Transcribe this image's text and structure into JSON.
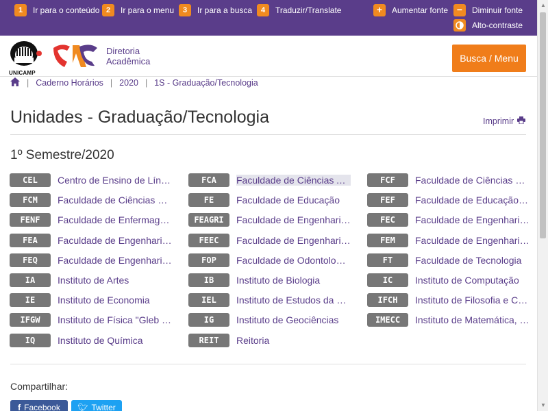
{
  "a11y": {
    "skip_content": {
      "num": "1",
      "label": "Ir para o conteúdo"
    },
    "skip_menu": {
      "num": "2",
      "label": "Ir para o menu"
    },
    "skip_search": {
      "num": "3",
      "label": "Ir para a busca"
    },
    "translate": {
      "num": "4",
      "label": "Traduzir/Translate"
    },
    "font_increase": "Aumentar fonte",
    "font_decrease": "Diminuir fonte",
    "high_contrast": "Alto-contraste"
  },
  "header": {
    "logo_text": "UNICAMP",
    "brand_line1": "Diretoria",
    "brand_line2": "Acadêmica",
    "search_menu": "Busca / Menu"
  },
  "breadcrumb": [
    "Caderno Horários",
    "2020",
    "1S - Graduação/Tecnologia"
  ],
  "main": {
    "title": "Unidades - Graduação/Tecnologia",
    "print": "Imprimir",
    "semester": "1º Semestre/2020"
  },
  "units": [
    [
      {
        "code": "CEL",
        "name": "Centro de Ensino de Línguas"
      },
      {
        "code": "FCM",
        "name": "Faculdade de Ciências Médicas"
      },
      {
        "code": "FENF",
        "name": "Faculdade de Enfermagem"
      },
      {
        "code": "FEA",
        "name": "Faculdade de Engenharia de Alimentos"
      },
      {
        "code": "FEQ",
        "name": "Faculdade de Engenharia Química"
      },
      {
        "code": "IA",
        "name": "Instituto de Artes"
      },
      {
        "code": "IE",
        "name": "Instituto de Economia"
      },
      {
        "code": "IFGW",
        "name": "Instituto de Física \"Gleb Wataghin\""
      },
      {
        "code": "IQ",
        "name": "Instituto de Química"
      }
    ],
    [
      {
        "code": "FCA",
        "name": "Faculdade de Ciências Aplicadas"
      },
      {
        "code": "FE",
        "name": "Faculdade de Educação"
      },
      {
        "code": "FEAGRI",
        "name": "Faculdade de Engenharia Agrícola"
      },
      {
        "code": "FEEC",
        "name": "Faculdade de Engenharia Elétrica e de Computação"
      },
      {
        "code": "FOP",
        "name": "Faculdade de Odontologia de Piracicaba"
      },
      {
        "code": "IB",
        "name": "Instituto de Biologia"
      },
      {
        "code": "IEL",
        "name": "Instituto de Estudos da Linguagem"
      },
      {
        "code": "IG",
        "name": "Instituto de Geociências"
      },
      {
        "code": "REIT",
        "name": "Reitoria"
      }
    ],
    [
      {
        "code": "FCF",
        "name": "Faculdade de Ciências Farmacêuticas"
      },
      {
        "code": "FEF",
        "name": "Faculdade de Educação Física"
      },
      {
        "code": "FEC",
        "name": "Faculdade de Engenharia Civil, Arquitetura e Urbanismo"
      },
      {
        "code": "FEM",
        "name": "Faculdade de Engenharia Mecânica"
      },
      {
        "code": "FT",
        "name": "Faculdade de Tecnologia"
      },
      {
        "code": "IC",
        "name": "Instituto de Computação"
      },
      {
        "code": "IFCH",
        "name": "Instituto de Filosofia e Ciências Humanas"
      },
      {
        "code": "IMECC",
        "name": "Instituto de Matemática, Estatística e Computação Científica"
      }
    ]
  ],
  "share": {
    "label": "Compartilhar:",
    "facebook": "Facebook",
    "twitter": "Twitter"
  },
  "colors": {
    "purple": "#5a3d8a",
    "orange": "#f07d1a",
    "code_badge": "#777777",
    "facebook": "#3b5998",
    "twitter": "#1da1f2"
  }
}
